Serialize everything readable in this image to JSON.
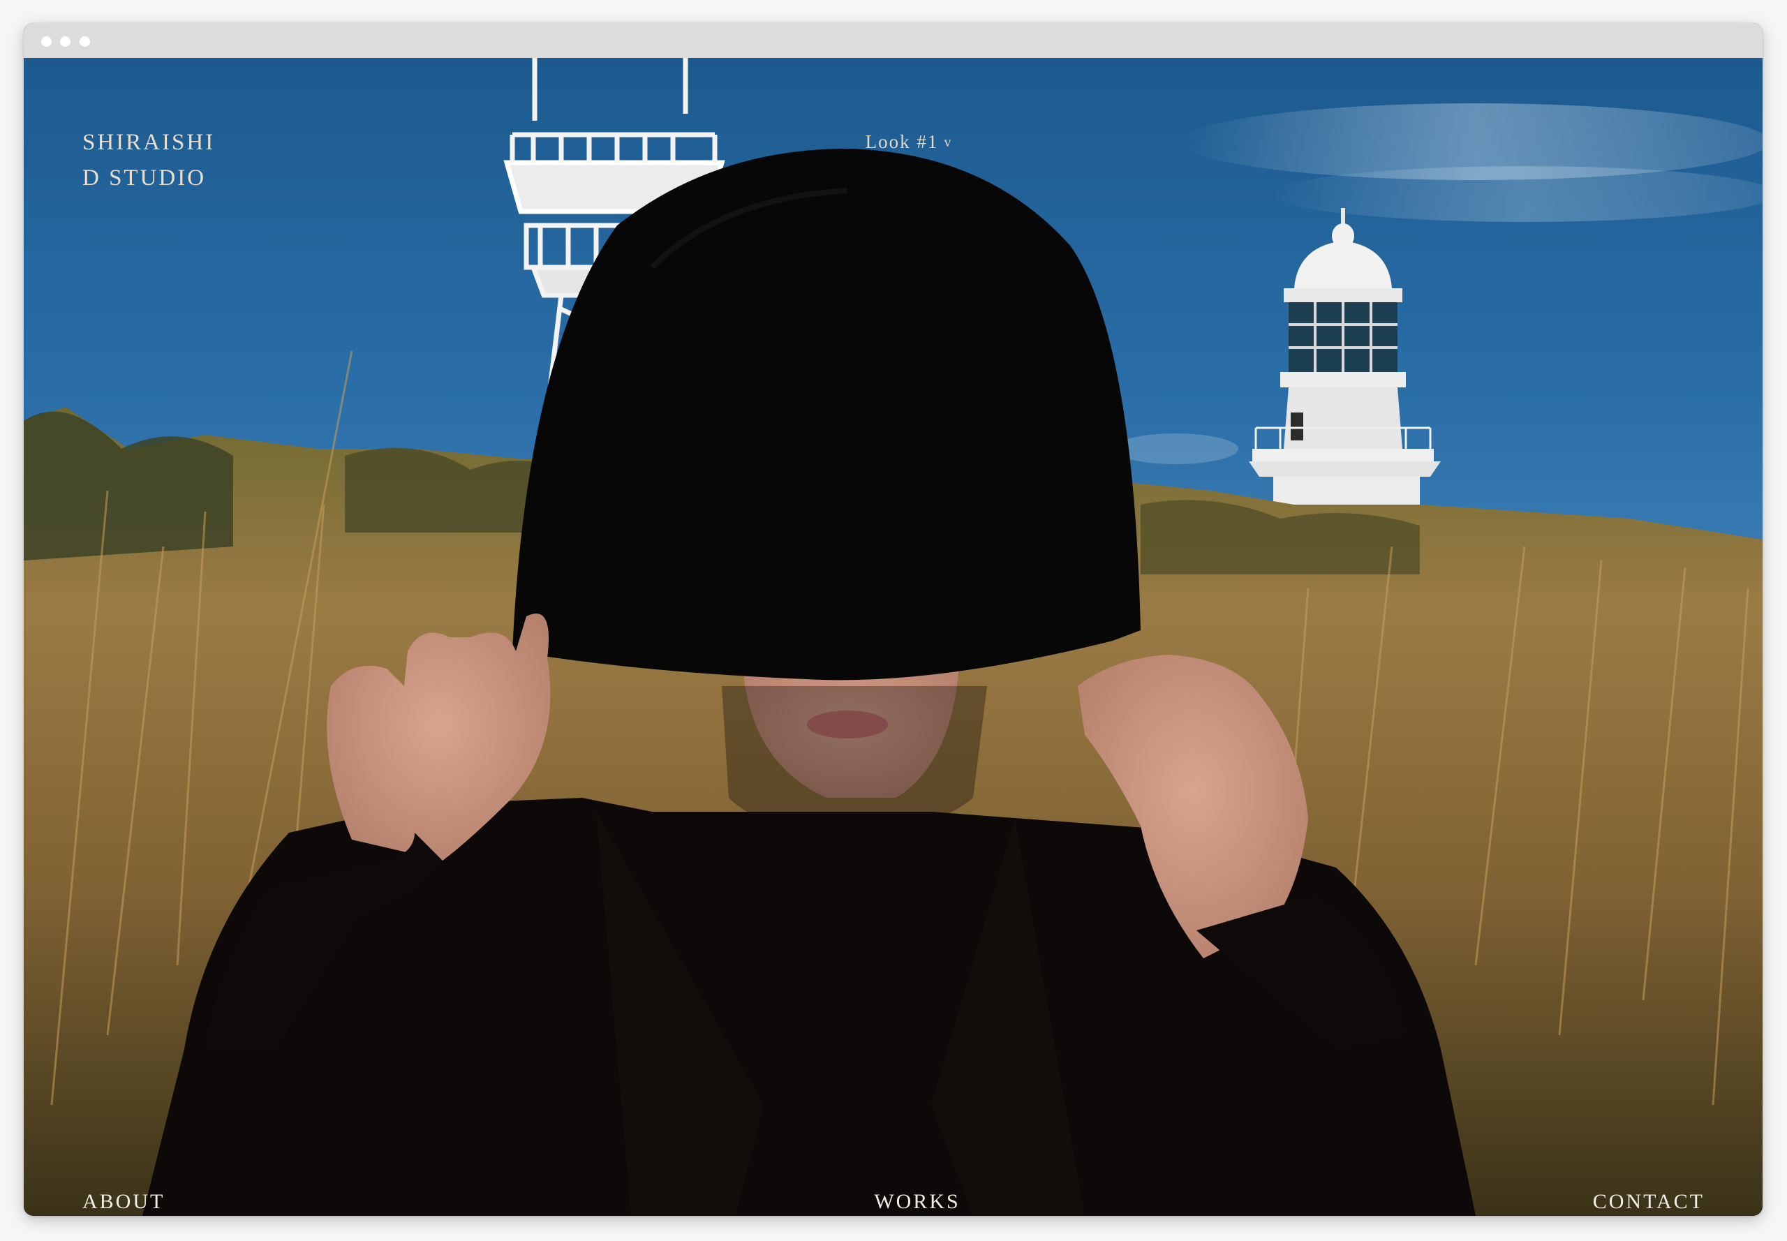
{
  "brand": {
    "line1": "SHIRAISHI",
    "line2": "D STUDIO"
  },
  "look_selector": {
    "label": "Look #1",
    "chevron": "v"
  },
  "nav": {
    "about": "ABOUT",
    "works": "WORKS",
    "contact": "CONTACT"
  },
  "colors": {
    "sky": "#1f5f93",
    "grass": "#9a7a45",
    "garment": "#0b0908",
    "text": "#e9dfcc"
  },
  "icons": {
    "window_controls": [
      "dot-icon",
      "dot-icon",
      "dot-icon"
    ],
    "look_chevron": "chevron-down-icon"
  }
}
